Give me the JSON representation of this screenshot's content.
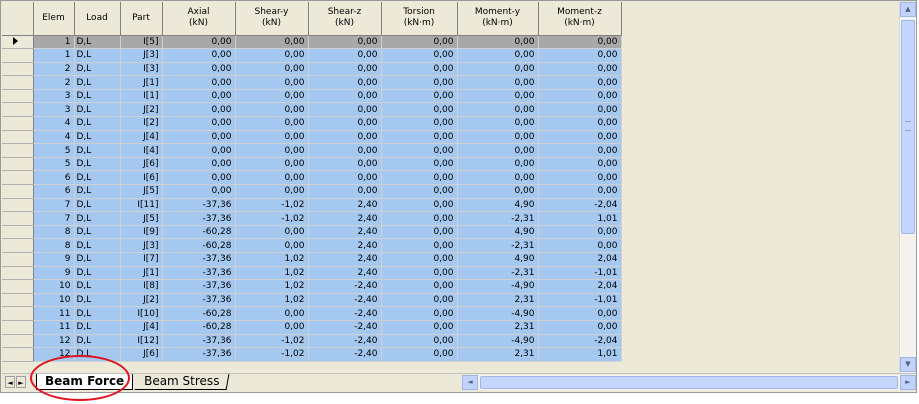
{
  "columns": [
    {
      "key": "rowhdr",
      "label": ""
    },
    {
      "key": "elem",
      "label": "Elem"
    },
    {
      "key": "load",
      "label": "Load"
    },
    {
      "key": "part",
      "label": "Part"
    },
    {
      "key": "axial",
      "label": "Axial\n(kN)"
    },
    {
      "key": "sheary",
      "label": "Shear-y\n(kN)"
    },
    {
      "key": "shearz",
      "label": "Shear-z\n(kN)"
    },
    {
      "key": "torsion",
      "label": "Torsion\n(kN·m)"
    },
    {
      "key": "momenty",
      "label": "Moment-y\n(kN·m)"
    },
    {
      "key": "momentz",
      "label": "Moment-z\n(kN·m)"
    }
  ],
  "rows": [
    {
      "elem": "1",
      "load": "D,L",
      "part": "I[5]",
      "axial": "0,00",
      "sheary": "0,00",
      "shearz": "0,00",
      "torsion": "0,00",
      "momenty": "0,00",
      "momentz": "0,00",
      "current": true
    },
    {
      "elem": "1",
      "load": "D,L",
      "part": "J[3]",
      "axial": "0,00",
      "sheary": "0,00",
      "shearz": "0,00",
      "torsion": "0,00",
      "momenty": "0,00",
      "momentz": "0,00"
    },
    {
      "elem": "2",
      "load": "D,L",
      "part": "I[3]",
      "axial": "0,00",
      "sheary": "0,00",
      "shearz": "0,00",
      "torsion": "0,00",
      "momenty": "0,00",
      "momentz": "0,00"
    },
    {
      "elem": "2",
      "load": "D,L",
      "part": "J[1]",
      "axial": "0,00",
      "sheary": "0,00",
      "shearz": "0,00",
      "torsion": "0,00",
      "momenty": "0,00",
      "momentz": "0,00"
    },
    {
      "elem": "3",
      "load": "D,L",
      "part": "I[1]",
      "axial": "0,00",
      "sheary": "0,00",
      "shearz": "0,00",
      "torsion": "0,00",
      "momenty": "0,00",
      "momentz": "0,00"
    },
    {
      "elem": "3",
      "load": "D,L",
      "part": "J[2]",
      "axial": "0,00",
      "sheary": "0,00",
      "shearz": "0,00",
      "torsion": "0,00",
      "momenty": "0,00",
      "momentz": "0,00"
    },
    {
      "elem": "4",
      "load": "D,L",
      "part": "I[2]",
      "axial": "0,00",
      "sheary": "0,00",
      "shearz": "0,00",
      "torsion": "0,00",
      "momenty": "0,00",
      "momentz": "0,00"
    },
    {
      "elem": "4",
      "load": "D,L",
      "part": "J[4]",
      "axial": "0,00",
      "sheary": "0,00",
      "shearz": "0,00",
      "torsion": "0,00",
      "momenty": "0,00",
      "momentz": "0,00"
    },
    {
      "elem": "5",
      "load": "D,L",
      "part": "I[4]",
      "axial": "0,00",
      "sheary": "0,00",
      "shearz": "0,00",
      "torsion": "0,00",
      "momenty": "0,00",
      "momentz": "0,00"
    },
    {
      "elem": "5",
      "load": "D,L",
      "part": "J[6]",
      "axial": "0,00",
      "sheary": "0,00",
      "shearz": "0,00",
      "torsion": "0,00",
      "momenty": "0,00",
      "momentz": "0,00"
    },
    {
      "elem": "6",
      "load": "D,L",
      "part": "I[6]",
      "axial": "0,00",
      "sheary": "0,00",
      "shearz": "0,00",
      "torsion": "0,00",
      "momenty": "0,00",
      "momentz": "0,00"
    },
    {
      "elem": "6",
      "load": "D,L",
      "part": "J[5]",
      "axial": "0,00",
      "sheary": "0,00",
      "shearz": "0,00",
      "torsion": "0,00",
      "momenty": "0,00",
      "momentz": "0,00"
    },
    {
      "elem": "7",
      "load": "D,L",
      "part": "I[11]",
      "axial": "-37,36",
      "sheary": "-1,02",
      "shearz": "2,40",
      "torsion": "0,00",
      "momenty": "4,90",
      "momentz": "-2,04"
    },
    {
      "elem": "7",
      "load": "D,L",
      "part": "J[5]",
      "axial": "-37,36",
      "sheary": "-1,02",
      "shearz": "2,40",
      "torsion": "0,00",
      "momenty": "-2,31",
      "momentz": "1,01"
    },
    {
      "elem": "8",
      "load": "D,L",
      "part": "I[9]",
      "axial": "-60,28",
      "sheary": "0,00",
      "shearz": "2,40",
      "torsion": "0,00",
      "momenty": "4,90",
      "momentz": "0,00"
    },
    {
      "elem": "8",
      "load": "D,L",
      "part": "J[3]",
      "axial": "-60,28",
      "sheary": "0,00",
      "shearz": "2,40",
      "torsion": "0,00",
      "momenty": "-2,31",
      "momentz": "0,00"
    },
    {
      "elem": "9",
      "load": "D,L",
      "part": "I[7]",
      "axial": "-37,36",
      "sheary": "1,02",
      "shearz": "2,40",
      "torsion": "0,00",
      "momenty": "4,90",
      "momentz": "2,04"
    },
    {
      "elem": "9",
      "load": "D,L",
      "part": "J[1]",
      "axial": "-37,36",
      "sheary": "1,02",
      "shearz": "2,40",
      "torsion": "0,00",
      "momenty": "-2,31",
      "momentz": "-1,01"
    },
    {
      "elem": "10",
      "load": "D,L",
      "part": "I[8]",
      "axial": "-37,36",
      "sheary": "1,02",
      "shearz": "-2,40",
      "torsion": "0,00",
      "momenty": "-4,90",
      "momentz": "2,04"
    },
    {
      "elem": "10",
      "load": "D,L",
      "part": "J[2]",
      "axial": "-37,36",
      "sheary": "1,02",
      "shearz": "-2,40",
      "torsion": "0,00",
      "momenty": "2,31",
      "momentz": "-1,01"
    },
    {
      "elem": "11",
      "load": "D,L",
      "part": "I[10]",
      "axial": "-60,28",
      "sheary": "0,00",
      "shearz": "-2,40",
      "torsion": "0,00",
      "momenty": "-4,90",
      "momentz": "0,00"
    },
    {
      "elem": "11",
      "load": "D,L",
      "part": "J[4]",
      "axial": "-60,28",
      "sheary": "0,00",
      "shearz": "-2,40",
      "torsion": "0,00",
      "momenty": "2,31",
      "momentz": "0,00"
    },
    {
      "elem": "12",
      "load": "D,L",
      "part": "I[12]",
      "axial": "-37,36",
      "sheary": "-1,02",
      "shearz": "-2,40",
      "torsion": "0,00",
      "momenty": "-4,90",
      "momentz": "-2,04"
    },
    {
      "elem": "12",
      "load": "D,L",
      "part": "J[6]",
      "axial": "-37,36",
      "sheary": "-1,02",
      "shearz": "-2,40",
      "torsion": "0,00",
      "momenty": "2,31",
      "momentz": "1,01"
    }
  ],
  "tabs": [
    {
      "label": "Beam Force",
      "active": true
    },
    {
      "label": "Beam Stress",
      "active": false
    }
  ],
  "nav": {
    "prev": "◄",
    "next": "►"
  },
  "colors": {
    "cell_bg": "#a4c8f0",
    "current_row_bg": "#a8a8a8",
    "header_bg": "#ece9d8",
    "highlight": "#e0141e"
  }
}
